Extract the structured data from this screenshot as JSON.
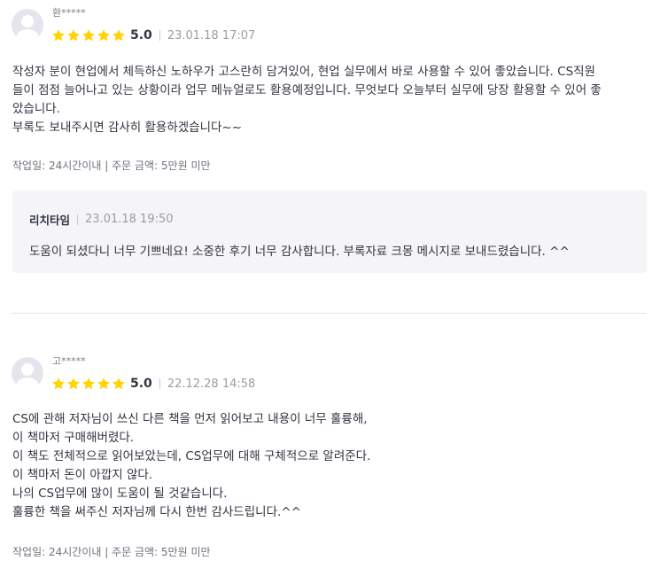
{
  "reviews": [
    {
      "nickname": "환*****",
      "rating": 5,
      "score": "5.0",
      "date": "23.01.18 17:07",
      "content": [
        "작성자 분이 현업에서 체득하신 노하우가 고스란히 담겨있어, 현업 실무에서 바로 사용할 수 있어 좋았습니다. CS직원",
        "들이 점점 늘어나고 있는 상황이라 업무 메뉴얼로도 활용예정입니다. 무엇보다 오늘부터 실무에 당장 활용할 수 있어 좋",
        "았습니다.",
        "부록도 보내주시면 감사히 활용하겠습니다~~"
      ],
      "meta": "작업일: 24시간이내 | 주문 금액: 5만원 미만",
      "reply": {
        "name": "리치타임",
        "date": "23.01.18 19:50",
        "text": "도움이 되셨다니 너무 기쁘네요! 소중한 후기 너무 감사합니다. 부록자료 크몽 메시지로 보내드렸습니다. ^^"
      }
    },
    {
      "nickname": "고*****",
      "rating": 5,
      "score": "5.0",
      "date": "22.12.28 14:58",
      "content": [
        "CS에 관해 저자님이 쓰신 다른 책을 먼저 읽어보고 내용이 너무 훌륭해,",
        "이 책마저 구매해버렸다.",
        "이 책도 전체적으로 읽어보았는데, CS업무에 대해 구체적으로 알려준다.",
        "이 책마저 돈이 아깝지 않다.",
        "나의 CS업무에 많이 도움이 될 것같습니다.",
        "훌륭한 책을 써주신 저자님께 다시 한번 감사드립니다.^^"
      ],
      "meta": "작업일: 24시간이내 | 주문 금액: 5만원 미만"
    }
  ],
  "colors": {
    "star": "#ffd400",
    "text": "#303441",
    "muted": "#9a9ca6",
    "reply_bg": "#f5f5f7"
  },
  "icons": {
    "star": "star-icon",
    "avatar": "default-avatar-icon"
  }
}
